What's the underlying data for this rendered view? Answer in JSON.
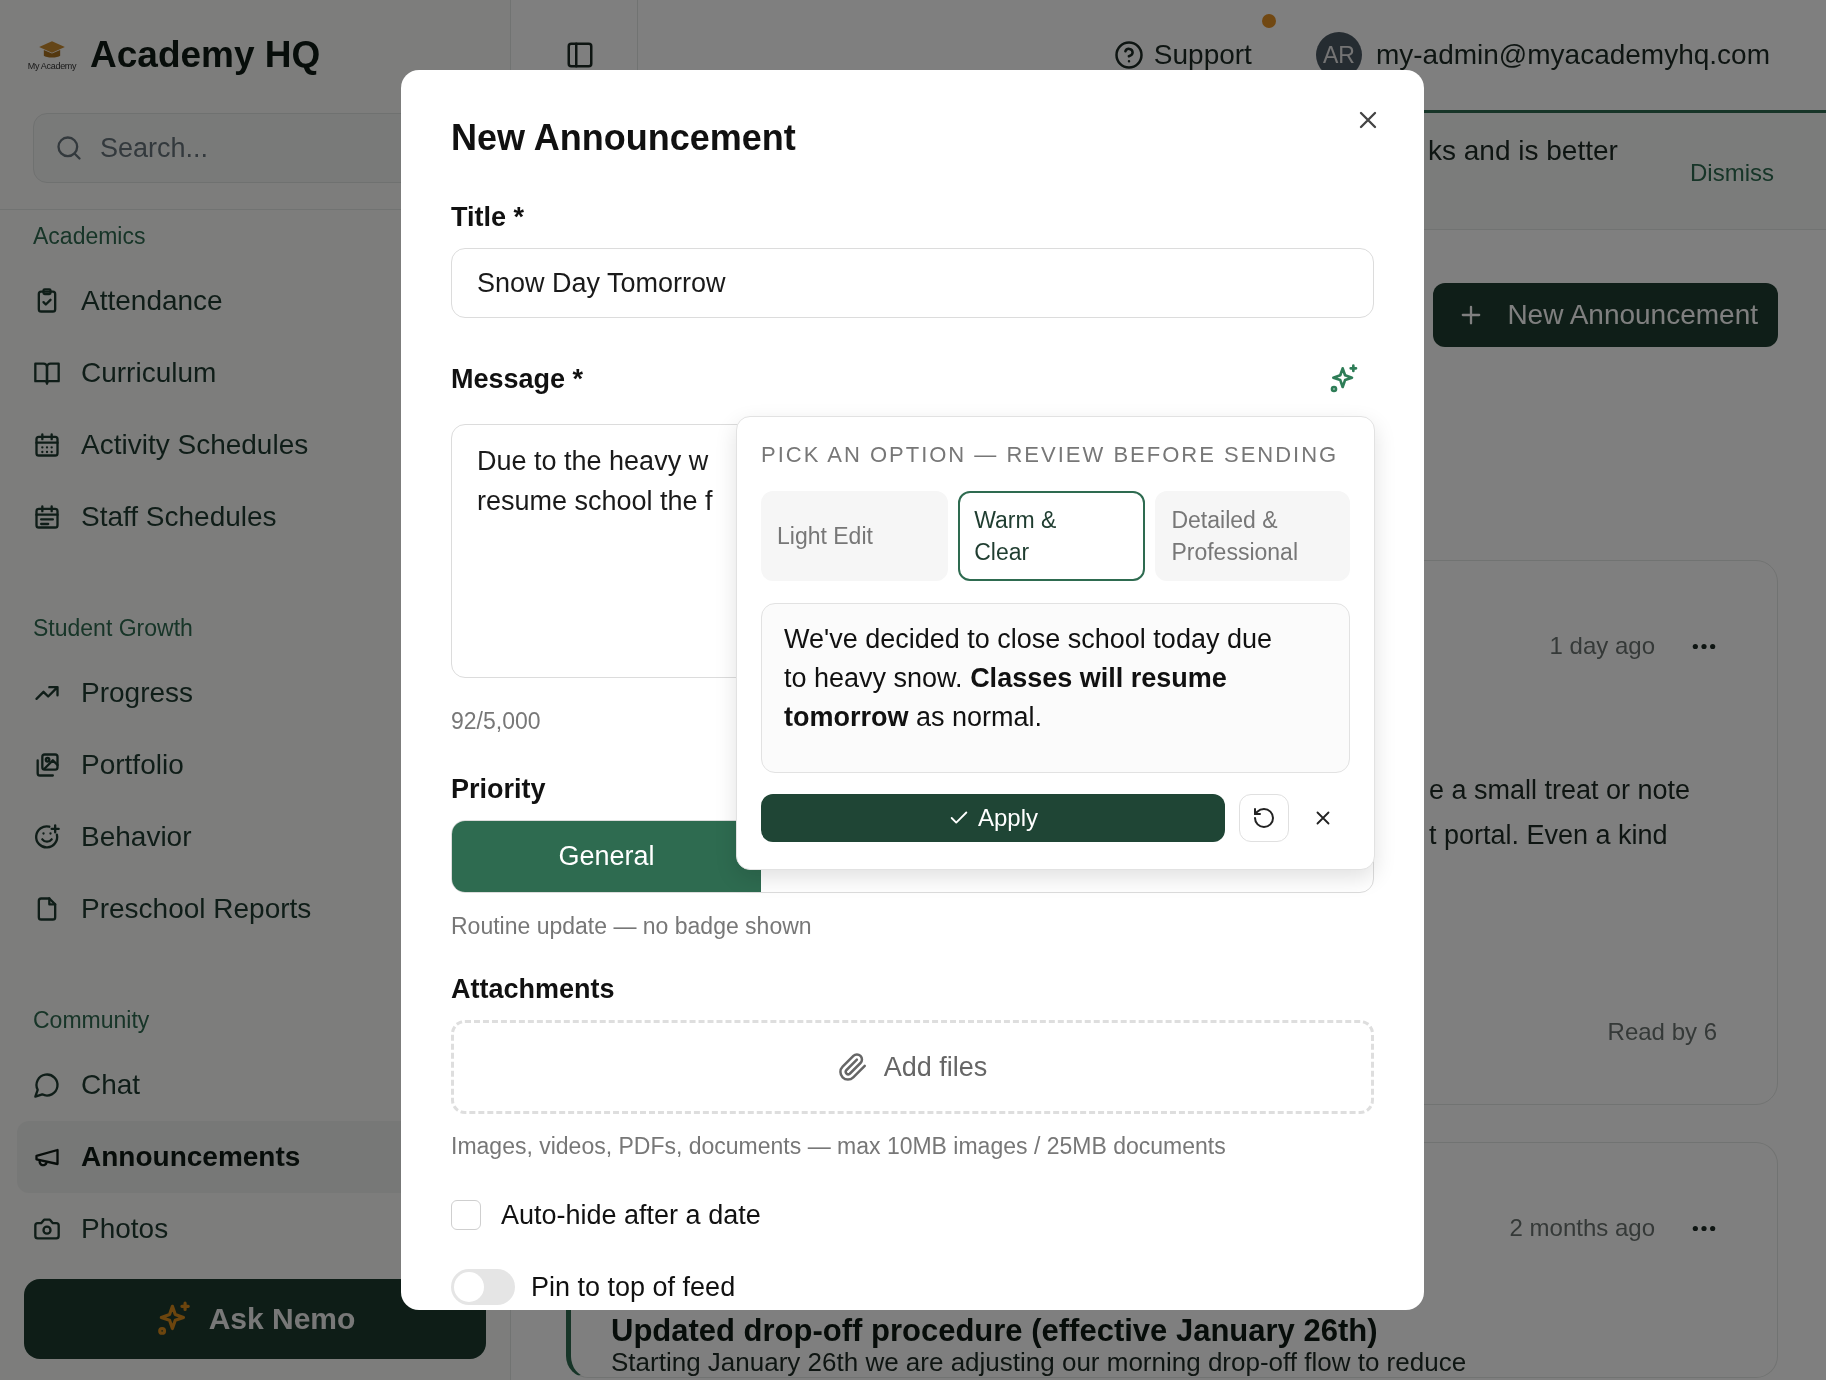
{
  "sidebar": {
    "brand": {
      "logo_text": "My Academy",
      "name": "Academy HQ"
    },
    "search": {
      "placeholder": "Search..."
    },
    "sections": [
      {
        "heading": "Academics",
        "items": [
          {
            "label": "Attendance",
            "selected": false
          },
          {
            "label": "Curriculum",
            "selected": false
          },
          {
            "label": "Activity Schedules",
            "selected": false
          },
          {
            "label": "Staff Schedules",
            "selected": false
          }
        ]
      },
      {
        "heading": "Student Growth",
        "items": [
          {
            "label": "Progress",
            "selected": false
          },
          {
            "label": "Portfolio",
            "selected": false
          },
          {
            "label": "Behavior",
            "selected": false
          },
          {
            "label": "Preschool Reports",
            "selected": false
          }
        ]
      },
      {
        "heading": "Community",
        "items": [
          {
            "label": "Chat",
            "selected": false
          },
          {
            "label": "Announcements",
            "selected": true
          },
          {
            "label": "Photos",
            "selected": false
          }
        ]
      }
    ],
    "ask_button": "Ask Nemo"
  },
  "top_bar": {
    "support": "Support",
    "notification": true,
    "avatar": "AR",
    "email": "my-admin@myacademyhq.com"
  },
  "banner": {
    "text": "ks and is better",
    "dismiss": "Dismiss"
  },
  "new_button": "New Announcement",
  "feed": [
    {
      "highlighted": false,
      "time": "1 day ago",
      "lines": [
        "e a small treat or note",
        "t portal. Even a kind"
      ],
      "read_by": "Read by 6"
    },
    {
      "highlighted": true,
      "time": "2 months ago",
      "title": "Updated drop-off procedure (effective January 26th)",
      "lines": [
        "Starting January 26th we are adjusting our morning drop-off flow to reduce"
      ]
    }
  ],
  "dialog": {
    "title": "New Announcement",
    "title_field": {
      "label": "Title *",
      "value": "Snow Day Tomorrow"
    },
    "message_field": {
      "label": "Message *",
      "value": "Due to the heavy w\nresume school the f",
      "counter": "92/5,000"
    },
    "rewrite_popover": {
      "heading": "PICK AN OPTION — REVIEW BEFORE SENDING",
      "options": [
        {
          "label": "Light Edit",
          "selected": false
        },
        {
          "label": "Warm & Clear",
          "selected": true
        },
        {
          "label": "Detailed & Professional",
          "selected": false
        }
      ],
      "preview": "We've decided to close school today due to heavy snow. **Classes will resume tomorrow** as normal.",
      "apply": "Apply"
    },
    "priority": {
      "label": "Priority",
      "options": [
        {
          "label": "General",
          "selected": true
        }
      ],
      "hint": "Routine update — no badge shown"
    },
    "attachments": {
      "label": "Attachments",
      "drop_label": "Add files",
      "hint": "Images, videos, PDFs, documents — max 10MB images / 25MB documents"
    },
    "settings": [
      {
        "kind": "checkbox",
        "label": "Auto-hide after a date",
        "checked": false
      },
      {
        "kind": "toggle",
        "label": "Pin to top of feed",
        "on": false
      }
    ]
  }
}
